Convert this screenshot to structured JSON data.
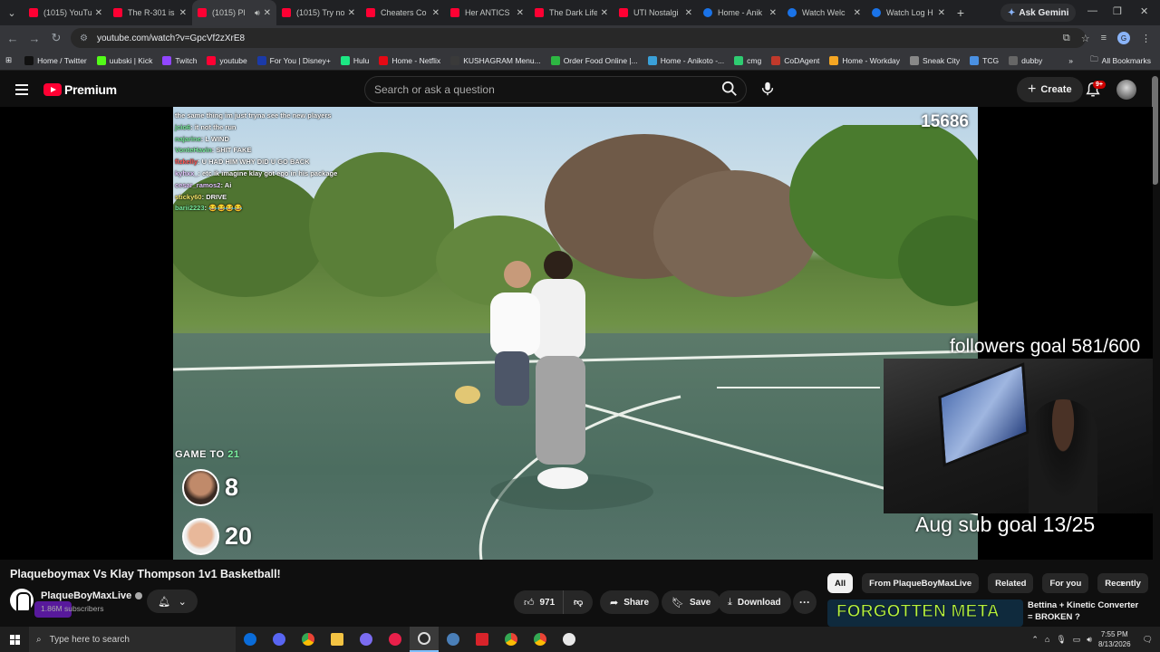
{
  "browser": {
    "tabs": [
      {
        "title": "(1015) YouTube",
        "icon": "youtube"
      },
      {
        "title": "The R-301 is",
        "icon": "youtube"
      },
      {
        "title": "(1015) Pl",
        "icon": "youtube",
        "active": true,
        "audio": true
      },
      {
        "title": "(1015) Try no",
        "icon": "youtube"
      },
      {
        "title": "Cheaters Co",
        "icon": "youtube"
      },
      {
        "title": "Her ANTICS",
        "icon": "youtube"
      },
      {
        "title": "The Dark Life",
        "icon": "youtube"
      },
      {
        "title": "UTI Nostalgi",
        "icon": "youtube"
      },
      {
        "title": "Home - Anik",
        "icon": "globe"
      },
      {
        "title": "Watch Welc",
        "icon": "globe"
      },
      {
        "title": "Watch Log H",
        "icon": "globe"
      }
    ],
    "ask_gemini": "Ask Gemini",
    "url": "youtube.com/watch?v=GpcVf2zXrE8",
    "profile_initial": "G",
    "bookmarks": [
      {
        "label": "Home / Twitter",
        "color": "#111111"
      },
      {
        "label": "uubski | Kick",
        "color": "#53fc18"
      },
      {
        "label": "Twitch",
        "color": "#9146ff"
      },
      {
        "label": "youtube",
        "color": "#ff0033"
      },
      {
        "label": "For You | Disney+",
        "color": "#1b3aa8"
      },
      {
        "label": "Hulu",
        "color": "#1ce783"
      },
      {
        "label": "Home - Netflix",
        "color": "#e50914"
      },
      {
        "label": "KUSHAGRAM Menu...",
        "color": "#3a3a3a"
      },
      {
        "label": "Order Food Online |...",
        "color": "#2db742"
      },
      {
        "label": "Home - Anikoto -...",
        "color": "#3aa0d8"
      },
      {
        "label": "cmg",
        "color": "#2ecc71"
      },
      {
        "label": "CoDAgent",
        "color": "#c0392b"
      },
      {
        "label": "Home - Workday",
        "color": "#f5a623"
      },
      {
        "label": "Sneak City",
        "color": "#888888"
      },
      {
        "label": "TCG",
        "color": "#4a90e2"
      },
      {
        "label": "dubby",
        "color": "#666666"
      }
    ],
    "all_bookmarks": "All Bookmarks"
  },
  "youtube": {
    "brand": "Premium",
    "search_placeholder": "Search or ask a question",
    "create_label": "Create",
    "notif_count": "9+"
  },
  "video": {
    "chat": [
      {
        "user": "",
        "msg": "the same thing im just tryna see the new players"
      },
      {
        "user": "jcio6",
        "msg": "it not the run"
      },
      {
        "user": "najarine",
        "msg": "L WIND"
      },
      {
        "user": "VonteHavin",
        "msg": "SHIT FAKE"
      },
      {
        "user": "fizkelly",
        "msg": "U HAD HIM WHY DID U GO BACK"
      },
      {
        "user": "kyhxx_",
        "msg": "etc ik imagine klay got ego in his package"
      },
      {
        "user": "cesar_ramos2",
        "msg": "Ai"
      },
      {
        "user": "sticky60",
        "msg": "DRIVE"
      },
      {
        "user": "barii2223",
        "msg": "😂😂😂😂"
      }
    ],
    "viewer_counter": "15686",
    "game_to_label": "GAME TO",
    "game_to_value": "21",
    "score_1": "8",
    "score_2": "20",
    "followers_goal": "followers goal 581/600",
    "sub_goal": "Aug sub goal 13/25"
  },
  "meta": {
    "title": "Plaqueboymax Vs Klay Thompson 1v1 Basketball!",
    "channel": "PlaqueBoyMaxLive",
    "subscribers": "1.86M subscribers",
    "likes": "971",
    "share_label": "Share",
    "save_label": "Save",
    "download_label": "Download"
  },
  "sidebar": {
    "chips": [
      "All",
      "From PlaqueBoyMaxLive",
      "Related",
      "For you",
      "Recently"
    ],
    "rec_thumb_text": "FORGOTTEN META",
    "rec_title": "Bettina + Kinetic Converter = BROKEN ?"
  },
  "taskbar": {
    "search_placeholder": "Type here to search",
    "time": "7:55 PM",
    "date": "8/13/2026"
  }
}
